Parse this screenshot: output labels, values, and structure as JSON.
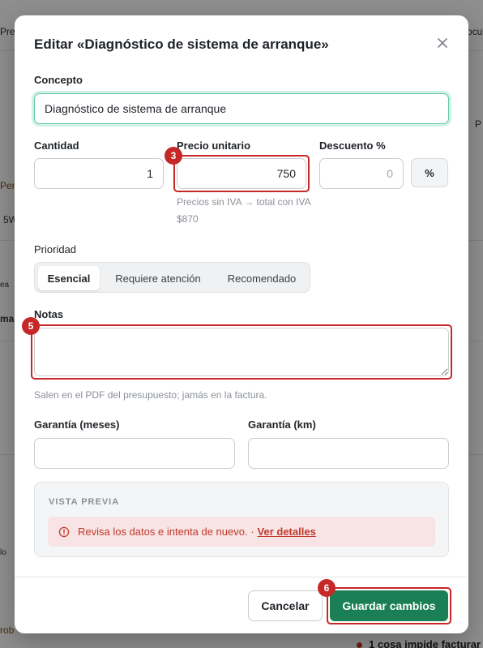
{
  "background": {
    "top_left_fragment": "Pre",
    "top_right_fragment": "ocu",
    "left_warn_fragment": "Pen",
    "left_fragment_5w": "5W",
    "left_fragment_ea": "ea",
    "left_fragment_ma": "ma",
    "left_fragment_lo": "lo",
    "left_warn_fragment_2": "rob",
    "right_fragment_p": "P",
    "bottom_status": "1 cosa impide facturar"
  },
  "modal": {
    "title": "Editar «Diagnóstico de sistema de arranque»",
    "close_icon": "close-icon"
  },
  "form": {
    "concept": {
      "label": "Concepto",
      "value": "Diagnóstico de sistema de arranque"
    },
    "quantity": {
      "label": "Cantidad",
      "value": "1"
    },
    "unit_price": {
      "label": "Precio unitario",
      "value": "750",
      "hint": "Precios sin IVA → total con IVA $870"
    },
    "discount": {
      "label": "Descuento %",
      "placeholder": "0",
      "unit": "%"
    },
    "priority": {
      "label": "Prioridad",
      "options": [
        "Esencial",
        "Requiere atención",
        "Recomendado"
      ],
      "selected": "Esencial"
    },
    "notes": {
      "label": "Notas",
      "value": "",
      "hint": "Salen en el PDF del presupuesto; jamás en la factura."
    },
    "warranty_months": {
      "label": "Garantía (meses)",
      "value": ""
    },
    "warranty_km": {
      "label": "Garantía (km)",
      "value": ""
    }
  },
  "preview": {
    "title": "VISTA PREVIA",
    "error_text": "Revisa los datos e intenta de nuevo. ·",
    "error_link": "Ver detalles",
    "error_icon": "alert-circle-icon"
  },
  "footer": {
    "cancel_label": "Cancelar",
    "save_label": "Guardar cambios"
  },
  "annotations": {
    "badge_price": "3",
    "badge_notes": "5",
    "badge_save": "6"
  },
  "colors": {
    "accent_green": "#1b7f55",
    "focus_green": "#5fc9a0",
    "error_red": "#c0392b",
    "highlight_red": "#c62828"
  }
}
